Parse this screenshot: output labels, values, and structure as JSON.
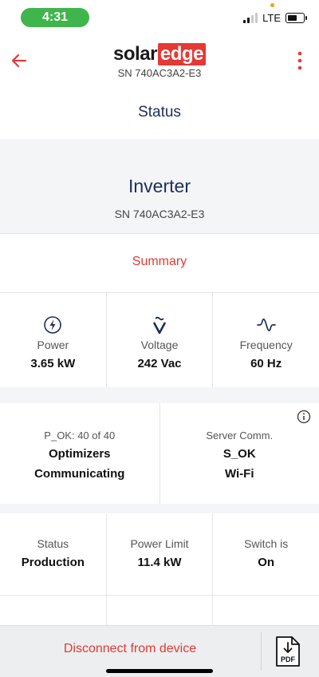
{
  "statusbar": {
    "time": "4:31",
    "network": "LTE"
  },
  "appbar": {
    "logo_solar": "solar",
    "logo_edge": "edge",
    "serial": "SN 740AC3A2-E3"
  },
  "status": {
    "title": "Status"
  },
  "inverter": {
    "title": "Inverter",
    "serial": "SN 740AC3A2-E3"
  },
  "summary": {
    "label": "Summary"
  },
  "metrics": [
    {
      "label": "Power",
      "value": "3.65 kW",
      "icon": "bolt-icon"
    },
    {
      "label": "Voltage",
      "value": "242 Vac",
      "icon": "voltage-icon"
    },
    {
      "label": "Frequency",
      "value": "60 Hz",
      "icon": "frequency-icon"
    }
  ],
  "optimizers": {
    "label": "P_OK: 40 of 40",
    "line1": "Optimizers",
    "line2": "Communicating"
  },
  "server": {
    "label": "Server Comm.",
    "line1": "S_OK",
    "line2": "Wi-Fi"
  },
  "grid": [
    {
      "label": "Status",
      "value": "Production"
    },
    {
      "label": "Power Limit",
      "value": "11.4 kW"
    },
    {
      "label": "Switch is",
      "value": "On"
    }
  ],
  "bottom": {
    "disconnect": "Disconnect from device",
    "pdf_label": "PDF"
  },
  "colors": {
    "accent": "#e53935",
    "navy": "#1c2e5b",
    "green": "#3fb54b"
  }
}
